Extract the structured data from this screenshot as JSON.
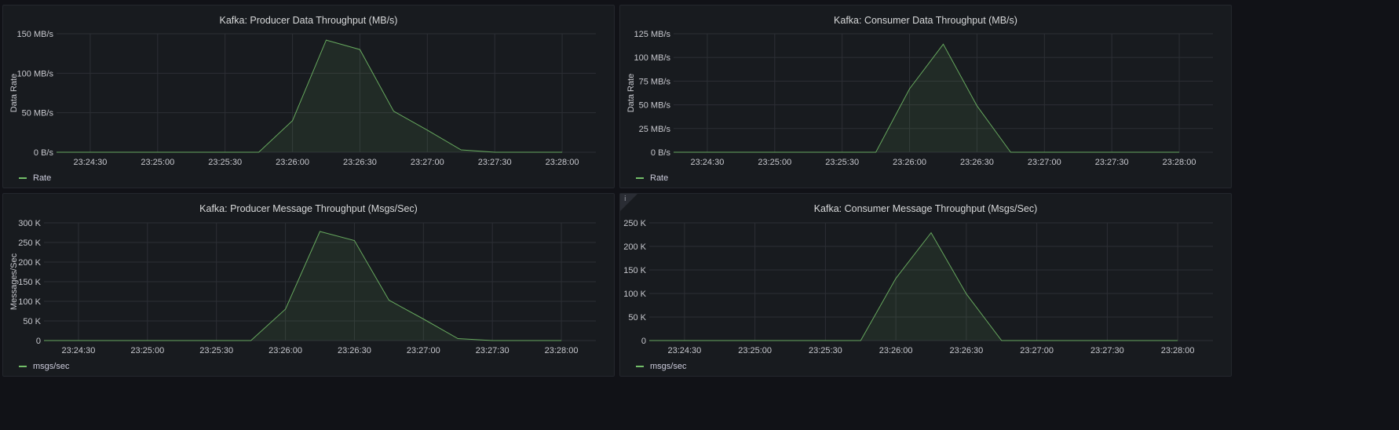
{
  "panels": [
    {
      "id": "producer-data",
      "title": "Kafka: Producer Data Throughput (MB/s)",
      "info_icon": false,
      "chart_data": {
        "type": "area",
        "title": "Kafka: Producer Data Throughput (MB/s)",
        "ylabel": "Data Rate",
        "yticks": [
          "0 B/s",
          "50 MB/s",
          "100 MB/s",
          "150 MB/s"
        ],
        "ylim": [
          0,
          150
        ],
        "xlim": [
          "23:24:15",
          "23:28:15"
        ],
        "xticks": [
          "23:24:30",
          "23:25:00",
          "23:25:30",
          "23:26:00",
          "23:26:30",
          "23:27:00",
          "23:27:30",
          "23:28:00"
        ],
        "series": [
          {
            "name": "Rate",
            "color": "#73bf69",
            "x": [
              "23:24:00",
              "23:25:45",
              "23:26:00",
              "23:26:15",
              "23:26:30",
              "23:26:45",
              "23:27:00",
              "23:27:15",
              "23:27:30",
              "23:28:00"
            ],
            "values": [
              0,
              0,
              40,
              142,
              130,
              52,
              28,
              3,
              0,
              0
            ]
          }
        ]
      }
    },
    {
      "id": "consumer-data",
      "title": "Kafka: Consumer Data Throughput (MB/s)",
      "info_icon": false,
      "chart_data": {
        "type": "area",
        "title": "Kafka: Consumer Data Throughput (MB/s)",
        "ylabel": "Data Rate",
        "yticks": [
          "0 B/s",
          "25 MB/s",
          "50 MB/s",
          "75 MB/s",
          "100 MB/s",
          "125 MB/s"
        ],
        "ylim": [
          0,
          125
        ],
        "xlim": [
          "23:24:15",
          "23:28:15"
        ],
        "xticks": [
          "23:24:30",
          "23:25:00",
          "23:25:30",
          "23:26:00",
          "23:26:30",
          "23:27:00",
          "23:27:30",
          "23:28:00"
        ],
        "series": [
          {
            "name": "Rate",
            "color": "#73bf69",
            "x": [
              "23:24:00",
              "23:25:45",
              "23:26:00",
              "23:26:15",
              "23:26:30",
              "23:26:45",
              "23:27:00",
              "23:28:00"
            ],
            "values": [
              0,
              0,
              67,
              114,
              49,
              0,
              0,
              0
            ]
          }
        ]
      }
    },
    {
      "id": "producer-msgs",
      "title": "Kafka: Producer Message Throughput (Msgs/Sec)",
      "info_icon": false,
      "chart_data": {
        "type": "area",
        "title": "Kafka: Producer Message Throughput (Msgs/Sec)",
        "ylabel": "Messages/Sec",
        "yticks": [
          "0",
          "50 K",
          "100 K",
          "150 K",
          "200 K",
          "250 K",
          "300 K"
        ],
        "ylim": [
          0,
          300
        ],
        "xlim": [
          "23:24:15",
          "23:28:15"
        ],
        "xticks": [
          "23:24:30",
          "23:25:00",
          "23:25:30",
          "23:26:00",
          "23:26:30",
          "23:27:00",
          "23:27:30",
          "23:28:00"
        ],
        "series": [
          {
            "name": "msgs/sec",
            "color": "#73bf69",
            "x": [
              "23:24:00",
              "23:25:45",
              "23:26:00",
              "23:26:15",
              "23:26:30",
              "23:26:45",
              "23:27:00",
              "23:27:15",
              "23:27:30",
              "23:28:00"
            ],
            "values": [
              0,
              0,
              80,
              278,
              255,
              103,
              55,
              5,
              0,
              0
            ]
          }
        ]
      }
    },
    {
      "id": "consumer-msgs",
      "title": "Kafka: Consumer Message Throughput (Msgs/Sec)",
      "info_icon": true,
      "info_glyph": "i",
      "chart_data": {
        "type": "area",
        "title": "Kafka: Consumer Message Throughput (Msgs/Sec)",
        "ylabel": "",
        "yticks": [
          "0",
          "50 K",
          "100 K",
          "150 K",
          "200 K",
          "250 K"
        ],
        "ylim": [
          0,
          250
        ],
        "xlim": [
          "23:24:15",
          "23:28:15"
        ],
        "xticks": [
          "23:24:30",
          "23:25:00",
          "23:25:30",
          "23:26:00",
          "23:26:30",
          "23:27:00",
          "23:27:30",
          "23:28:00"
        ],
        "series": [
          {
            "name": "msgs/sec",
            "color": "#73bf69",
            "x": [
              "23:24:00",
              "23:25:45",
              "23:26:00",
              "23:26:15",
              "23:26:30",
              "23:26:45",
              "23:27:00",
              "23:28:00"
            ],
            "values": [
              0,
              0,
              132,
              229,
              99,
              0,
              0,
              0
            ]
          }
        ]
      }
    }
  ]
}
